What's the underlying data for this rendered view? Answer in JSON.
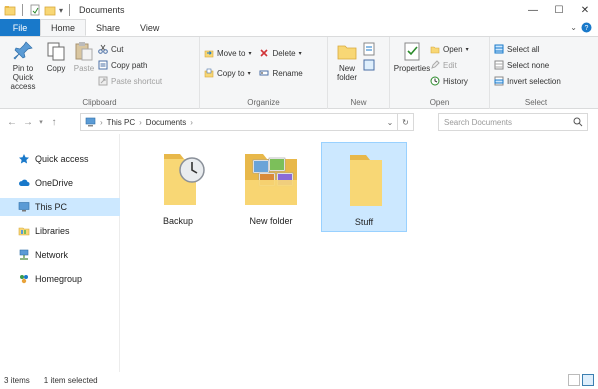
{
  "window": {
    "title": "Documents",
    "controls": {
      "minimize": "—",
      "maximize": "☐",
      "close": "✕"
    }
  },
  "tabs": {
    "file": "File",
    "items": [
      "Home",
      "Share",
      "View"
    ],
    "active": "Home"
  },
  "ribbon": {
    "clipboard": {
      "label": "Clipboard",
      "pin": "Pin to Quick access",
      "copy": "Copy",
      "paste": "Paste",
      "cut": "Cut",
      "copy_path": "Copy path",
      "paste_shortcut": "Paste shortcut"
    },
    "organize": {
      "label": "Organize",
      "move_to": "Move to",
      "copy_to": "Copy to",
      "delete": "Delete",
      "rename": "Rename"
    },
    "new": {
      "label": "New",
      "new_folder": "New folder"
    },
    "open": {
      "label": "Open",
      "properties": "Properties",
      "open": "Open",
      "edit": "Edit",
      "history": "History"
    },
    "select": {
      "label": "Select",
      "select_all": "Select all",
      "select_none": "Select none",
      "invert": "Invert selection"
    }
  },
  "address": {
    "path": [
      "This PC",
      "Documents"
    ],
    "search_placeholder": "Search Documents"
  },
  "navpane": {
    "items": [
      {
        "label": "Quick access",
        "icon": "star-icon"
      },
      {
        "label": "OneDrive",
        "icon": "cloud-icon"
      },
      {
        "label": "This PC",
        "icon": "computer-icon",
        "selected": true
      },
      {
        "label": "Libraries",
        "icon": "library-icon"
      },
      {
        "label": "Network",
        "icon": "network-icon"
      },
      {
        "label": "Homegroup",
        "icon": "homegroup-icon"
      }
    ]
  },
  "files": [
    {
      "name": "Backup",
      "icon": "backup-folder-icon"
    },
    {
      "name": "New folder",
      "icon": "photos-folder-icon"
    },
    {
      "name": "Stuff",
      "icon": "folder-icon",
      "selected": true
    }
  ],
  "status": {
    "items": "3 items",
    "selected": "1 item selected"
  },
  "colors": {
    "accent": "#1979ca",
    "selection": "#cce8ff",
    "folder": "#f8d775"
  }
}
